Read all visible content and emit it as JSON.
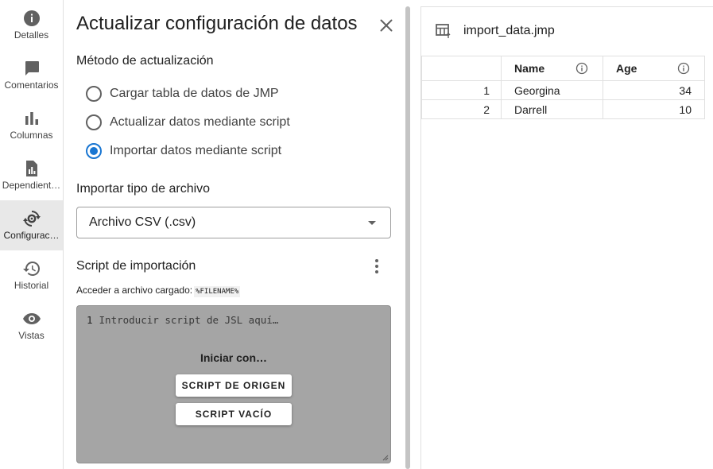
{
  "rail": {
    "items": [
      {
        "label": "Detalles",
        "icon": "info-icon"
      },
      {
        "label": "Comentarios",
        "icon": "comment-icon"
      },
      {
        "label": "Columnas",
        "icon": "bar-chart-icon"
      },
      {
        "label": "Dependient…",
        "icon": "document-chart-icon"
      },
      {
        "label": "Configurac…",
        "icon": "sync-settings-icon",
        "active": true
      },
      {
        "label": "Historial",
        "icon": "history-icon"
      },
      {
        "label": "Vistas",
        "icon": "eye-icon"
      }
    ]
  },
  "panel": {
    "title": "Actualizar configuración de datos",
    "update_method_label": "Método de actualización",
    "radios": [
      {
        "label": "Cargar tabla de datos de JMP",
        "checked": false
      },
      {
        "label": "Actualizar datos mediante script",
        "checked": false
      },
      {
        "label": "Importar datos mediante script",
        "checked": true
      }
    ],
    "file_type_label": "Importar tipo de archivo",
    "file_type_value": "Archivo CSV (.csv)",
    "import_script_label": "Script de importación",
    "hint_text": "Acceder a archivo cargado:",
    "hint_code": "%FILENAME%",
    "editor": {
      "line_number": "1",
      "placeholder": "Introducir script de JSL aquí…",
      "start_with": "Iniciar con…",
      "btn_source": "SCRIPT DE ORIGEN",
      "btn_empty": "SCRIPT VACÍO"
    }
  },
  "dataview": {
    "title": "import_data.jmp",
    "columns": [
      "Name",
      "Age"
    ],
    "rows": [
      {
        "num": "1",
        "name": "Georgina",
        "age": "34"
      },
      {
        "num": "2",
        "name": "Darrell",
        "age": "10"
      }
    ]
  },
  "colors": {
    "accent": "#1976d2",
    "editor_bg": "#a5a5a5",
    "active_rail": "#e8e8e8"
  }
}
